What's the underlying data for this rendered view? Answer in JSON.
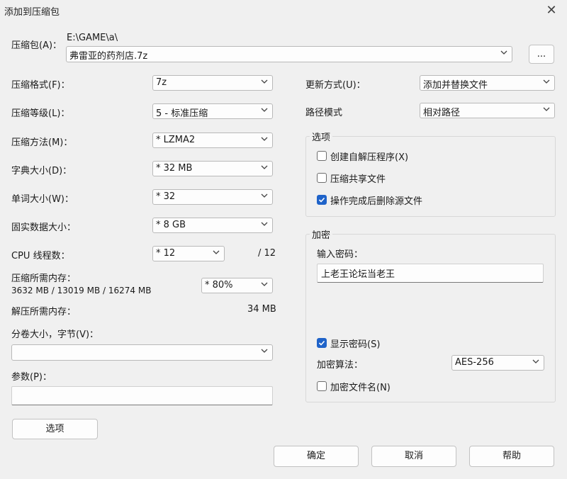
{
  "window": {
    "title": "添加到压缩包"
  },
  "archive": {
    "label": "压缩包(A)：",
    "path": "E:\\GAME\\a\\",
    "filename": "弗雷亚的药剂店.7z",
    "browse_label": "..."
  },
  "left": {
    "format": {
      "label": "压缩格式(F)：",
      "value": "7z"
    },
    "level": {
      "label": "压缩等级(L)：",
      "value": "5 - 标准压缩"
    },
    "method": {
      "label": "压缩方法(M)：",
      "value": "* LZMA2"
    },
    "dict": {
      "label": "字典大小(D)：",
      "value": "* 32 MB"
    },
    "word": {
      "label": "单词大小(W)：",
      "value": "* 32"
    },
    "solid": {
      "label": "固实数据大小：",
      "value": "* 8 GB"
    },
    "cpu": {
      "label": "CPU 线程数：",
      "value": "* 12",
      "max": "/ 12"
    },
    "mem_compress": {
      "label": "压缩所需内存：",
      "detail": "3632 MB / 13019 MB / 16274 MB",
      "value": "* 80%"
    },
    "mem_decompress": {
      "label": "解压所需内存：",
      "value": "34 MB"
    },
    "volume": {
      "label": "分卷大小，字节(V)：",
      "value": ""
    },
    "params": {
      "label": "参数(P)：",
      "value": ""
    },
    "options_button": "选项"
  },
  "right": {
    "update": {
      "label": "更新方式(U)：",
      "value": "添加并替换文件"
    },
    "pathmode": {
      "label": "路径模式",
      "value": "相对路径"
    },
    "options_group": {
      "title": "选项",
      "items": [
        {
          "label": "创建自解压程序(X)",
          "checked": false
        },
        {
          "label": "压缩共享文件",
          "checked": false
        },
        {
          "label": "操作完成后删除源文件",
          "checked": true
        }
      ]
    },
    "encrypt_group": {
      "title": "加密",
      "password_label": "输入密码：",
      "password": "上老王论坛当老王",
      "show_password": {
        "label": "显示密码(S)",
        "checked": true
      },
      "method_label": "加密算法：",
      "method_value": "AES-256",
      "encrypt_names": {
        "label": "加密文件名(N)",
        "checked": false
      }
    }
  },
  "footer": {
    "ok": "确定",
    "cancel": "取消",
    "help": "帮助"
  },
  "colors": {
    "accent": "#1f63c9",
    "background": "#f0f0f0"
  }
}
